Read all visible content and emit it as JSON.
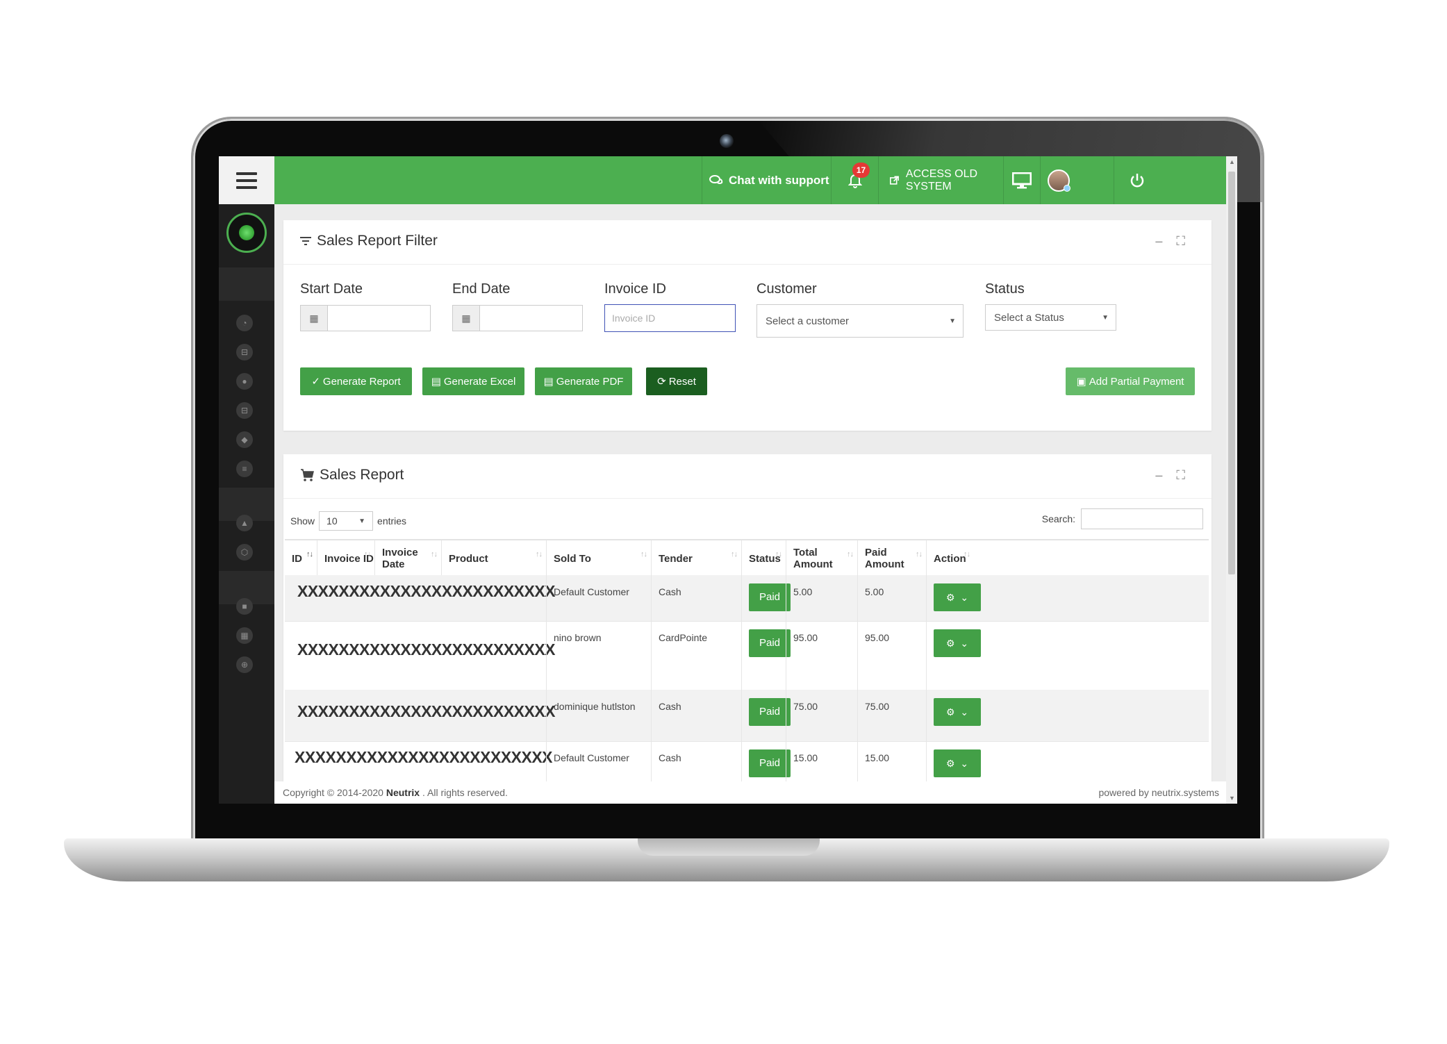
{
  "topbar": {
    "chat_label": "Chat with support",
    "notification_count": "17",
    "access_old_label": "ACCESS OLD SYSTEM"
  },
  "filter": {
    "title": "Sales Report Filter",
    "start_date_label": "Start Date",
    "end_date_label": "End Date",
    "invoice_id_label": "Invoice ID",
    "invoice_id_placeholder": "Invoice ID",
    "customer_label": "Customer",
    "customer_placeholder": "Select a customer",
    "status_label": "Status",
    "status_placeholder": "Select a Status",
    "buttons": {
      "generate_report": "Generate Report",
      "generate_excel": "Generate Excel",
      "generate_pdf": "Generate PDF",
      "reset": "Reset",
      "add_partial_payment": "Add Partial Payment"
    }
  },
  "report": {
    "title": "Sales Report",
    "show_label": "Show",
    "entries_value": "10",
    "entries_label": "entries",
    "search_label": "Search:",
    "columns": [
      "ID",
      "Invoice ID",
      "Invoice Date",
      "Product",
      "Sold To",
      "Tender",
      "Status",
      "Total Amount",
      "Paid Amount",
      "Action"
    ],
    "rows": [
      {
        "masked": "XXXXXXXXXXXXXXXXXXXXXXXXX",
        "sold_to": "Default Customer",
        "tender": "Cash",
        "status": "Paid",
        "total": "5.00",
        "paid": "5.00"
      },
      {
        "masked": "XXXXXXXXXXXXXXXXXXXXXXXXX",
        "sold_to": "nino brown",
        "tender": "CardPointe",
        "status": "Paid",
        "total": "95.00",
        "paid": "95.00"
      },
      {
        "masked": "XXXXXXXXXXXXXXXXXXXXXXXXX",
        "sold_to": "dominique hutlston",
        "tender": "Cash",
        "status": "Paid",
        "total": "75.00",
        "paid": "75.00"
      },
      {
        "masked": "XXXXXXXXXXXXXXXXXXXXXXXXX",
        "sold_to": "Default Customer",
        "tender": "Cash",
        "status": "Paid",
        "total": "15.00",
        "paid": "15.00"
      }
    ]
  },
  "footer": {
    "copyright": "Copyright © 2014-2020",
    "brand": "Neutrix",
    "rights": ". All rights reserved.",
    "powered": "powered by neutrix.systems"
  },
  "colors": {
    "brand_green": "#4caf50",
    "button_green": "#43a047",
    "reset_dark_green": "#1b5e20",
    "badge_red": "#e53935",
    "sidebar_dark": "#1f1f1f"
  },
  "icons": [
    "hamburger-menu-icon",
    "chat-icon",
    "bell-icon",
    "external-link-icon",
    "monitor-icon",
    "power-icon",
    "filter-icon",
    "cart-icon",
    "calendar-icon",
    "gear-icon"
  ]
}
